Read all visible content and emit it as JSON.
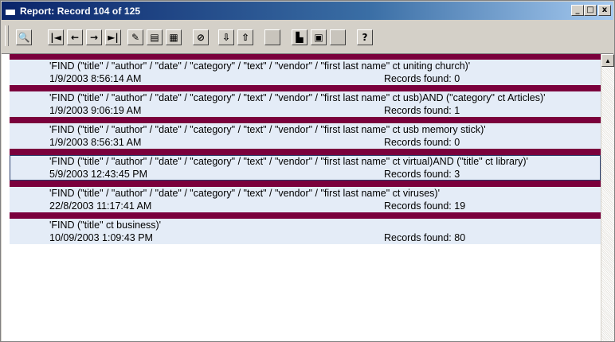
{
  "window": {
    "title": "Report: Record 104 of 125",
    "minimize_glyph": "_",
    "maximize_glyph": "□",
    "close_glyph": "x"
  },
  "toolbar": {
    "buttons": [
      {
        "name": "preview-button",
        "icon": "magnify-icon",
        "glyph": "🔍",
        "disabled": false
      },
      {
        "name": "first-record-button",
        "icon": "first-icon",
        "glyph": "|◄",
        "disabled": false
      },
      {
        "name": "previous-record-button",
        "icon": "arrow-left-icon",
        "glyph": "←",
        "disabled": false
      },
      {
        "name": "next-record-button",
        "icon": "arrow-right-icon",
        "glyph": "→",
        "disabled": false
      },
      {
        "name": "last-record-button",
        "icon": "last-icon",
        "glyph": "►|",
        "disabled": false
      },
      {
        "name": "edit-button",
        "icon": "pencil-icon",
        "glyph": "✎",
        "disabled": false
      },
      {
        "name": "new-record-button",
        "icon": "new-record-icon",
        "glyph": "▤",
        "disabled": false
      },
      {
        "name": "fields-button",
        "icon": "fields-icon",
        "glyph": "▦",
        "disabled": false
      },
      {
        "name": "delete-button",
        "icon": "delete-icon",
        "glyph": "⊘",
        "disabled": false
      },
      {
        "name": "import-button",
        "icon": "import-icon",
        "glyph": "⇩",
        "disabled": false
      },
      {
        "name": "export-button",
        "icon": "export-icon",
        "glyph": "⇧",
        "disabled": false
      },
      {
        "name": "disabled-button-1",
        "icon": "blank-icon",
        "glyph": "",
        "disabled": true
      },
      {
        "name": "report-button",
        "icon": "report-icon",
        "glyph": "▙",
        "disabled": false
      },
      {
        "name": "form-button",
        "icon": "form-icon",
        "glyph": "▣",
        "disabled": false
      },
      {
        "name": "disabled-button-2",
        "icon": "blank-icon",
        "glyph": "",
        "disabled": true
      },
      {
        "name": "help-button",
        "icon": "help-icon",
        "glyph": "?",
        "disabled": false
      }
    ]
  },
  "records": [
    {
      "query": "'FIND (\"title\" / \"author\" / \"date\" / \"category\" / \"text\" / \"vendor\" / \"first last name\" ct uniting church)'",
      "date": "1/9/2003 8:56:14 AM",
      "found": "Records found: 0",
      "selected": false
    },
    {
      "query": "'FIND (\"title\" / \"author\" / \"date\" / \"category\" / \"text\" / \"vendor\" / \"first last name\" ct usb)AND (\"category\" ct Articles)'",
      "date": "1/9/2003 9:06:19 AM",
      "found": "Records found: 1",
      "selected": false
    },
    {
      "query": "'FIND (\"title\" / \"author\" / \"date\" / \"category\" / \"text\" / \"vendor\" / \"first last name\" ct usb memory stick)'",
      "date": "1/9/2003 8:56:31 AM",
      "found": "Records found: 0",
      "selected": false
    },
    {
      "query": "'FIND (\"title\" / \"author\" / \"date\" / \"category\" / \"text\" / \"vendor\" / \"first last name\" ct virtual)AND (\"title\" ct library)'",
      "date": "5/9/2003 12:43:45 PM",
      "found": "Records found: 3",
      "selected": true
    },
    {
      "query": "'FIND (\"title\" / \"author\" / \"date\" / \"category\" / \"text\" / \"vendor\" / \"first last name\" ct viruses)'",
      "date": "22/8/2003 11:17:41 AM",
      "found": "Records found: 19",
      "selected": false
    },
    {
      "query": "'FIND (\"title\" ct business)'",
      "date": "10/09/2003 1:09:43 PM",
      "found": "Records found: 80",
      "selected": false
    }
  ],
  "scrollbar": {
    "up_glyph": "▲"
  },
  "colors": {
    "separator": "#7a003c",
    "record_background": "#e4ecf7",
    "titlebar": "#0a246a"
  }
}
